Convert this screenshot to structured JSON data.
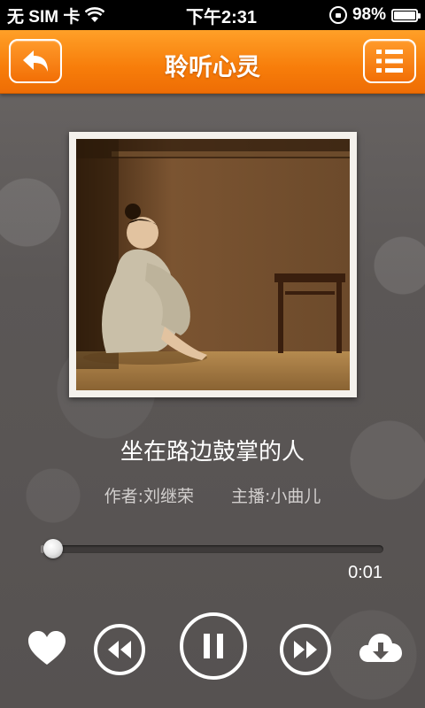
{
  "status_bar": {
    "carrier": "无 SIM 卡",
    "time": "下午2:31",
    "battery": "98%",
    "battery_level": 0.98
  },
  "header": {
    "title": "聆听心灵",
    "back_icon": "back-arrow-icon",
    "list_icon": "playlist-icon"
  },
  "album": {
    "art": "album-cover-image"
  },
  "song": {
    "title": "坐在路边鼓掌的人",
    "author": "作者:刘继荣",
    "narrator": "主播:小曲儿"
  },
  "player": {
    "elapsed": "0:01",
    "progress": 0.01,
    "icons": {
      "favorite": "heart-icon",
      "rewind": "rewind-icon",
      "play_state": "pause-icon",
      "forward": "fast-forward-icon",
      "download": "cloud-download-icon"
    }
  },
  "colors": {
    "header": "#f77d0a",
    "background": "#5a5655"
  }
}
